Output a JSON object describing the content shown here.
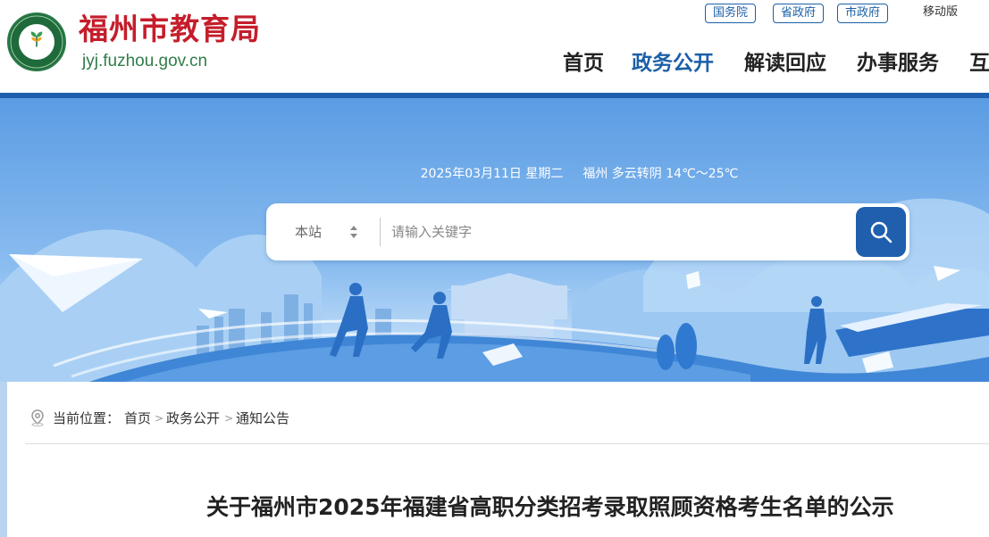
{
  "header": {
    "title": "福州市教育局",
    "domain": "jyj.fuzhou.gov.cn",
    "logo_icon": "education-logo-icon",
    "top_links": [
      "国务院",
      "省政府",
      "市政府"
    ],
    "mobile": "移动版",
    "nav": [
      "首页",
      "政务公开",
      "解读回应",
      "办事服务",
      "互"
    ],
    "active_nav": "政务公开"
  },
  "hero": {
    "date": "2025年03月11日 星期二",
    "weather": "福州 多云转阴 14℃～25℃"
  },
  "search": {
    "scope": "本站",
    "placeholder": "请输入关键字",
    "search_icon": "search-icon"
  },
  "breadcrumb": {
    "prefix": "当前位置：",
    "items": [
      "首页",
      "政务公开",
      "通知公告"
    ],
    "separator": ">"
  },
  "article": {
    "title": "关于福州市2025年福建省高职分类招考录取照顾资格考生名单的公示"
  },
  "colors": {
    "brand_red": "#c51d2b",
    "brand_green": "#2f7d48",
    "brand_blue": "#1f5fad",
    "hero_blue": "#5f9fe3"
  }
}
